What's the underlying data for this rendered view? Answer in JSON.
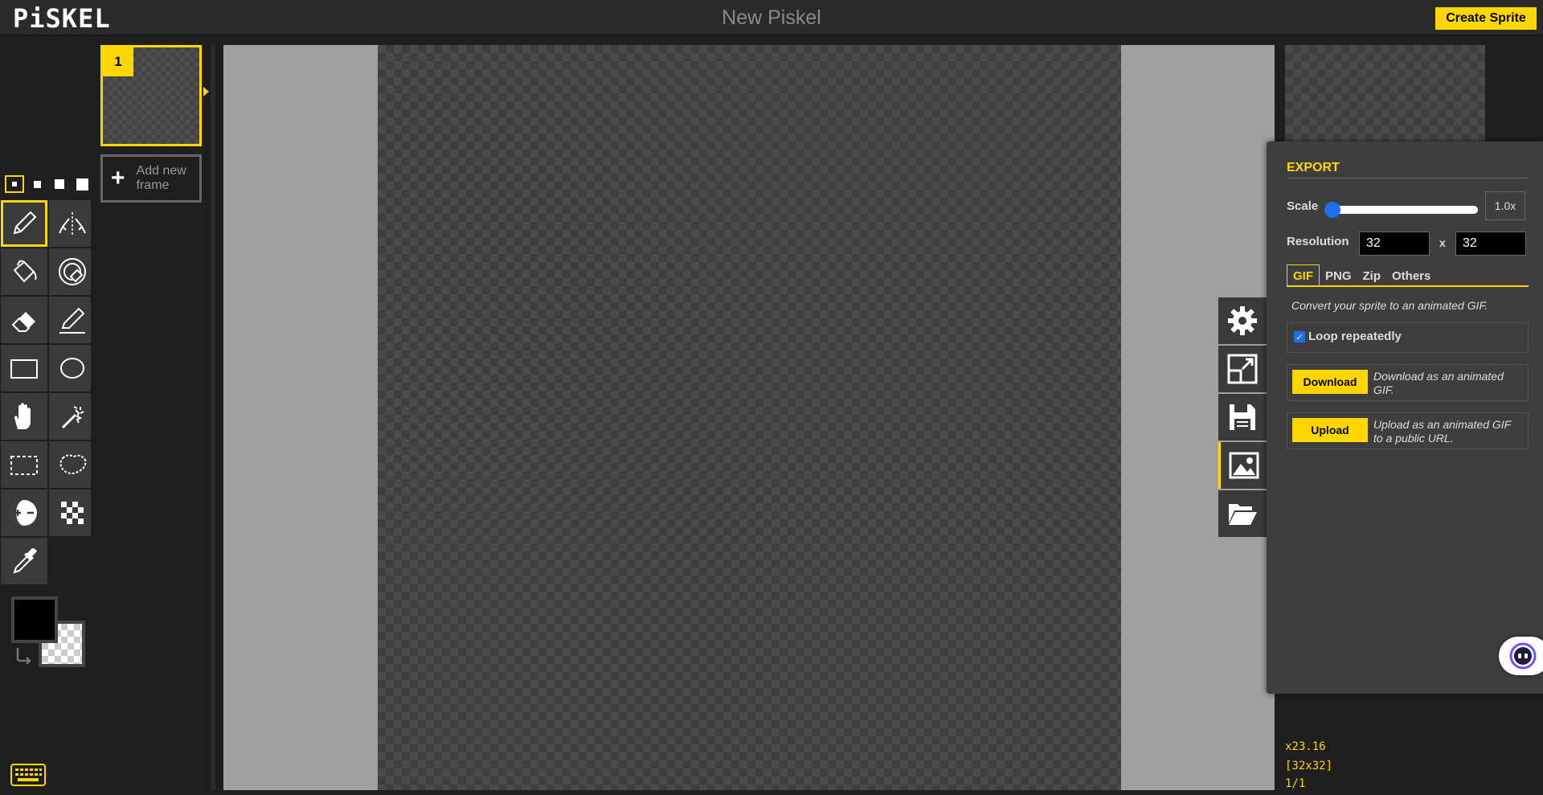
{
  "header": {
    "logo": "PiSKEL",
    "title": "New Piskel",
    "create_label": "Create Sprite"
  },
  "tools": {
    "pen_sizes": [
      "1",
      "2",
      "3",
      "4"
    ],
    "items": [
      "pen-icon",
      "mirror-pen-icon",
      "paint-bucket-icon",
      "paint-all-icon",
      "eraser-icon",
      "stroke-icon",
      "rectangle-icon",
      "circle-icon",
      "move-icon",
      "shape-select-icon",
      "rectangle-select-icon",
      "lasso-select-icon",
      "lighten-icon",
      "dithering-icon",
      "color-picker-icon"
    ],
    "primary_color": "#000000"
  },
  "frames": {
    "items": [
      {
        "number": "1"
      }
    ],
    "add_label_1": "Add new",
    "add_label_2": "frame"
  },
  "info": {
    "zoom": "x23.16",
    "size": "[32x32]",
    "frame": "1/1"
  },
  "export": {
    "title": "EXPORT",
    "scale_label": "Scale",
    "scale_value": "1.0x",
    "resolution_label": "Resolution",
    "width": "32",
    "x_label": "x",
    "height": "32",
    "tabs": [
      "GIF",
      "PNG",
      "Zip",
      "Others"
    ],
    "active_tab": "GIF",
    "description": "Convert your sprite to an animated GIF.",
    "loop_label": "Loop repeatedly",
    "loop_checked": true,
    "download_label": "Download",
    "download_desc": "Download as an animated GIF.",
    "upload_label": "Upload",
    "upload_desc": "Upload as an animated GIF to a public URL."
  },
  "colors": {
    "accent": "#ffd700",
    "background": "#1e1e1e",
    "panel": "#3e3e3e"
  }
}
